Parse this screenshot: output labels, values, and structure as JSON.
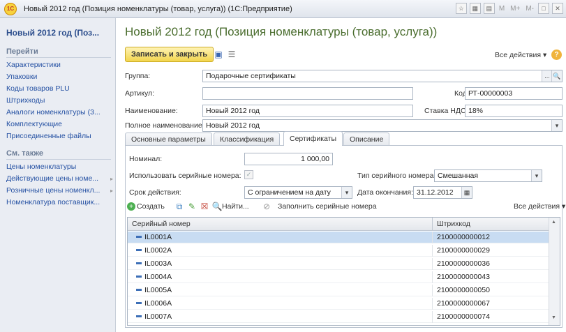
{
  "window": {
    "app_logo": "1С",
    "title": "Новый 2012 год (Позиция номенклатуры (товар, услуга)) (1С:Предприятие)",
    "controls": [
      "M",
      "M+",
      "M-"
    ]
  },
  "sidebar": {
    "title": "Новый 2012 год (Поз...",
    "section_go": "Перейти",
    "go_items": [
      "Характеристики",
      "Упаковки",
      "Коды товаров PLU",
      "Штрихкоды",
      "Аналоги номенклатуры (3...",
      "Комплектующие",
      "Присоединенные файлы"
    ],
    "section_also": "См. также",
    "also_items": [
      "Цены номенклатуры",
      "Действующие цены номе...",
      "Розничные цены номенкл...",
      "Номенклатура поставщик..."
    ]
  },
  "main": {
    "title": "Новый 2012 год (Позиция номенклатуры (товар, услуга))",
    "save_close": "Записать и закрыть",
    "all_actions": "Все действия ▾",
    "help": "?",
    "group_label": "Группа:",
    "group_value": "Подарочные сертификаты",
    "article_label": "Артикул:",
    "article_value": "",
    "code_label": "Код:",
    "code_value": "РТ-00000003",
    "name_label": "Наименование:",
    "name_value": "Новый 2012 год",
    "vat_label": "Ставка НДС:",
    "vat_value": "18%",
    "fullname_label": "Полное наименование:",
    "fullname_value": "Новый 2012 год"
  },
  "tabs": [
    "Основные параметры",
    "Классификация",
    "Сертификаты",
    "Описание"
  ],
  "cert": {
    "nominal_label": "Номинал:",
    "nominal_value": "1 000,00",
    "use_serial_label": "Использовать серийные номера:",
    "serial_type_label": "Тип серийного номера:",
    "serial_type_value": "Смешанная",
    "validity_label": "Срок действия:",
    "validity_value": "С ограничением на дату",
    "end_date_label": "Дата окончания:",
    "end_date_value": "31.12.2012"
  },
  "toolbar": {
    "create": "Создать",
    "find": "Найти...",
    "fill_serial": "Заполнить серийные номера",
    "all_actions": "Все действия ▾"
  },
  "table": {
    "columns": [
      "Серийный номер",
      "Штрихкод"
    ],
    "rows": [
      {
        "serial": "IL0001A",
        "barcode": "2100000000012"
      },
      {
        "serial": "IL0002A",
        "barcode": "2100000000029"
      },
      {
        "serial": "IL0003A",
        "barcode": "2100000000036"
      },
      {
        "serial": "IL0004A",
        "barcode": "2100000000043"
      },
      {
        "serial": "IL0005A",
        "barcode": "2100000000050"
      },
      {
        "serial": "IL0006A",
        "barcode": "2100000000067"
      },
      {
        "serial": "IL0007A",
        "barcode": "2100000000074"
      }
    ]
  }
}
